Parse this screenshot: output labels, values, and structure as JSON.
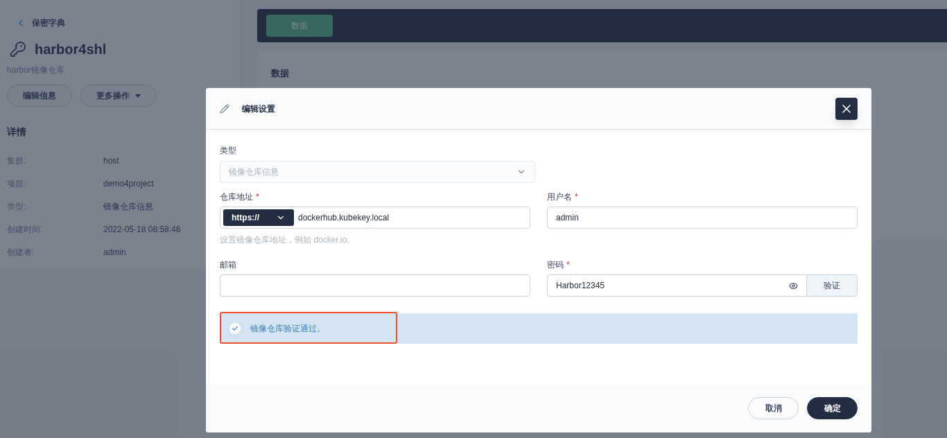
{
  "breadcrumb": {
    "back_label": "保密字典"
  },
  "secret": {
    "name": "harbor4shl",
    "description": "harbor镜像仓库"
  },
  "actions": [
    {
      "label": "编辑信息",
      "has_caret": false
    },
    {
      "label": "更多操作",
      "has_caret": true
    }
  ],
  "details": {
    "title": "详情",
    "rows": [
      {
        "label": "集群:",
        "value": "host"
      },
      {
        "label": "项目:",
        "value": "demo4project"
      },
      {
        "label": "类型:",
        "value": "镜像仓库信息"
      },
      {
        "label": "创建时间:",
        "value": "2022-05-18 08:58:46"
      },
      {
        "label": "创建者:",
        "value": "admin"
      }
    ]
  },
  "tabs": [
    {
      "label": "数据",
      "selected": true
    }
  ],
  "data_card": {
    "title": "数据"
  },
  "dialog": {
    "title": "编辑设置",
    "type_field": {
      "label": "类型",
      "value": "镜像仓库信息",
      "disabled": true
    },
    "address_field": {
      "label": "仓库地址",
      "required_mark": "*",
      "protocol": "https://",
      "value": "dockerhub.kubekey.local",
      "hint": "设置镜像仓库地址，例如 docker.io。"
    },
    "username_field": {
      "label": "用户名",
      "required_mark": "*",
      "value": "admin"
    },
    "email_field": {
      "label": "邮箱"
    },
    "password_field": {
      "label": "密码",
      "required_mark": "*",
      "value": "Harbor12345",
      "verify_button": "验证"
    },
    "alert": {
      "kind": "success",
      "text": "镜像仓库验证通过。",
      "highlighted": true
    },
    "buttons": [
      {
        "label": "取消",
        "kind": "secondary"
      },
      {
        "label": "确定",
        "kind": "primary"
      }
    ]
  }
}
